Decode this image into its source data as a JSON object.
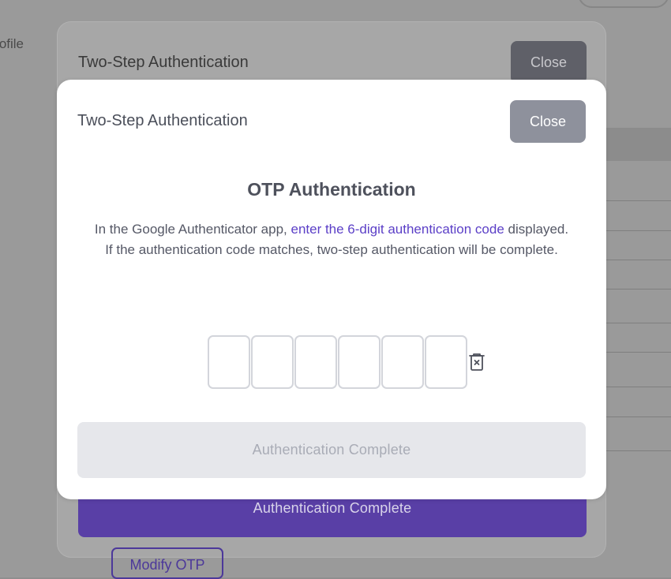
{
  "background": {
    "profile_label": "Profile"
  },
  "back_modal": {
    "title": "Two-Step Authentication",
    "close_label": "Close",
    "submit_label": "Authentication Complete",
    "modify_label": "Modify OTP"
  },
  "modal": {
    "title": "Two-Step Authentication",
    "close_label": "Close",
    "heading": "OTP Authentication",
    "desc_line1_prefix": "In the Google Authenticator app, ",
    "desc_line1_link": "enter the 6-digit authentication code",
    "desc_line1_suffix": " displayed.",
    "desc_line2": "If the authentication code matches, two-step authentication will be complete.",
    "otp_values": [
      "",
      "",
      "",
      "",
      "",
      ""
    ],
    "clear_icon": "trash-x-icon",
    "submit_label": "Authentication Complete",
    "submit_disabled": true
  },
  "colors": {
    "accent": "#5b3fc7",
    "primary_button": "#593fa6",
    "close_button": "#8e919c",
    "disabled_button": "#e6e7eb"
  }
}
